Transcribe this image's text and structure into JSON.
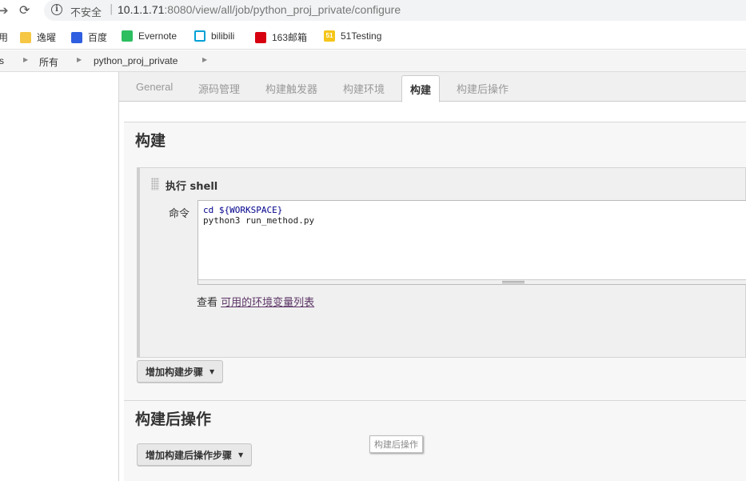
{
  "browser": {
    "security_label": "不安全",
    "separator": "|",
    "url_host": "10.1.1.71",
    "url_rest": ":8080/view/all/job/python_proj_private/configure"
  },
  "bookmarks": [
    {
      "label": "用",
      "icon": "apps-icon"
    },
    {
      "label": "逸曜",
      "icon": "folder-icon"
    },
    {
      "label": "百度",
      "icon": "baidu-icon"
    },
    {
      "label": "Evernote",
      "icon": "evernote-icon"
    },
    {
      "label": "bilibili",
      "icon": "bilibili-icon"
    },
    {
      "label": "163邮箱",
      "icon": "mail163-icon"
    },
    {
      "label": "51Testing",
      "icon": "51testing-icon",
      "icon_text": "51"
    }
  ],
  "breadcrumb": {
    "items": [
      "s",
      "所有",
      "python_proj_private"
    ]
  },
  "tabs": [
    {
      "label": "General",
      "active": false
    },
    {
      "label": "源码管理",
      "active": false
    },
    {
      "label": "构建触发器",
      "active": false
    },
    {
      "label": "构建环境",
      "active": false
    },
    {
      "label": "构建",
      "active": true
    },
    {
      "label": "构建后操作",
      "active": false
    }
  ],
  "build": {
    "title": "构建",
    "step_title": "执行 shell",
    "command_label": "命令",
    "command_line1_kw": "cd ${WORKSPACE}",
    "command_line2": "python3 run_method.py",
    "env_prefix": "查看 ",
    "env_link": "可用的环境变量列表",
    "add_step_button": "增加构建步骤"
  },
  "post_build": {
    "title": "构建后操作",
    "add_step_button": "增加构建后操作步骤",
    "tooltip": "构建后操作"
  }
}
